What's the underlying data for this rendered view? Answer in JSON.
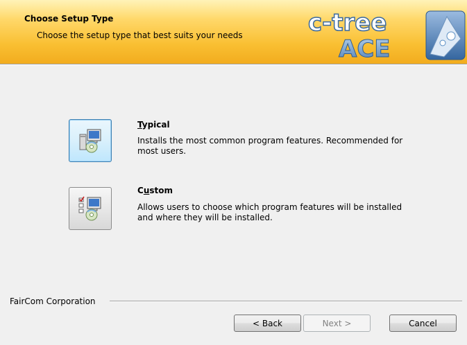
{
  "header": {
    "title": "Choose Setup Type",
    "subtitle": "Choose the setup type that best suits your needs",
    "logo_text_top": "c-tree",
    "logo_text_bottom": "ACE"
  },
  "options": [
    {
      "title_accel": "T",
      "title_rest": "ypical",
      "description_line1": "Installs the most common program features. Recommended for",
      "description_line2": "most users.",
      "icon": "computer-cd-icon",
      "focused": true
    },
    {
      "title_pre": "C",
      "title_accel": "u",
      "title_rest": "stom",
      "description_line1": "Allows users to choose which program features will be installed",
      "description_line2": "and where they will be installed.",
      "icon": "computer-cd-checklist-icon",
      "focused": false
    }
  ],
  "footer": {
    "company": "FairCom Corporation",
    "back_label": "< Back",
    "next_label": "Next >",
    "cancel_label": "Cancel",
    "next_enabled": false
  },
  "colors": {
    "banner_gold": "#f9bf32",
    "logo_blue": "#5b8fc4",
    "focus_border": "#3c7fb1"
  }
}
